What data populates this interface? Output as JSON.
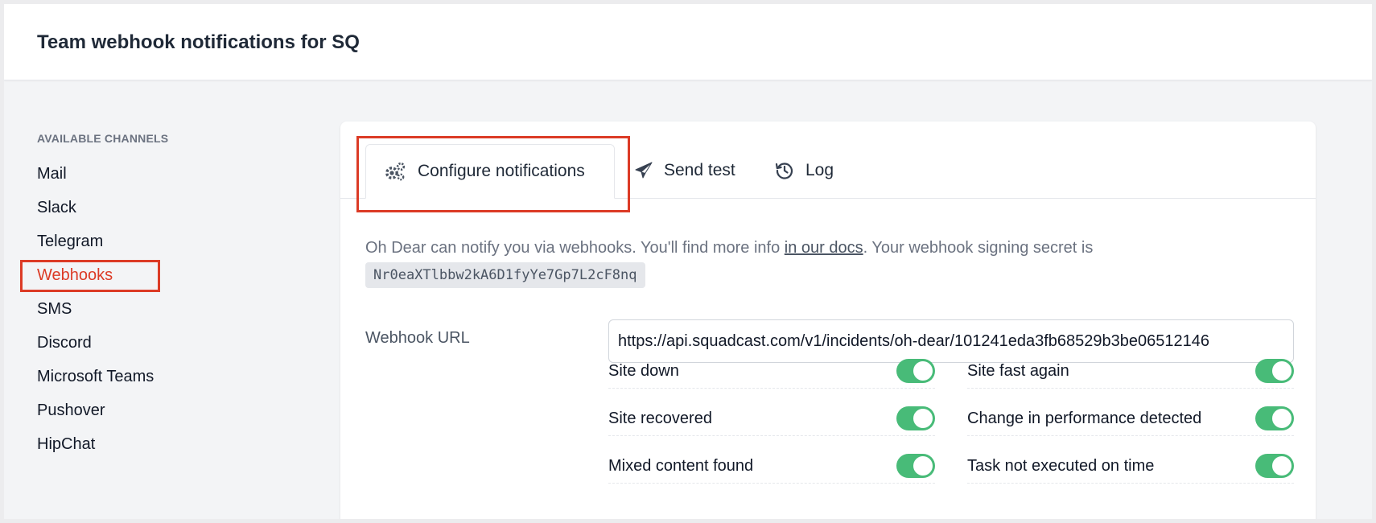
{
  "header": {
    "title": "Team webhook notifications for SQ"
  },
  "sidebar": {
    "heading": "AVAILABLE CHANNELS",
    "items": [
      {
        "label": "Mail"
      },
      {
        "label": "Slack"
      },
      {
        "label": "Telegram"
      },
      {
        "label": "Webhooks",
        "active": true
      },
      {
        "label": "SMS"
      },
      {
        "label": "Discord"
      },
      {
        "label": "Microsoft Teams"
      },
      {
        "label": "Pushover"
      },
      {
        "label": "HipChat"
      }
    ]
  },
  "tabs": [
    {
      "label": "Configure notifications",
      "icon": "cogs-icon",
      "active": true
    },
    {
      "label": "Send test",
      "icon": "paper-plane-icon"
    },
    {
      "label": "Log",
      "icon": "history-icon"
    }
  ],
  "intro": {
    "text_before": "Oh Dear can notify you via webhooks. You'll find more info ",
    "link": "in our docs",
    "text_after": ". Your webhook signing secret is",
    "secret": "Nr0eaXTlbbw2kA6D1fyYe7Gp7L2cF8nq"
  },
  "webhook": {
    "label": "Webhook URL",
    "value": "https://api.squadcast.com/v1/incidents/oh-dear/101241eda3fb68529b3be06512146"
  },
  "toggles": {
    "left": [
      {
        "label": "Site down",
        "on": true
      },
      {
        "label": "Site recovered",
        "on": true
      },
      {
        "label": "Mixed content found",
        "on": true
      }
    ],
    "right": [
      {
        "label": "Site fast again",
        "on": true
      },
      {
        "label": "Change in performance detected",
        "on": true
      },
      {
        "label": "Task not executed on time",
        "on": true
      }
    ]
  },
  "colors": {
    "accent": "#dc3b26",
    "toggle_on": "#48bb78"
  }
}
